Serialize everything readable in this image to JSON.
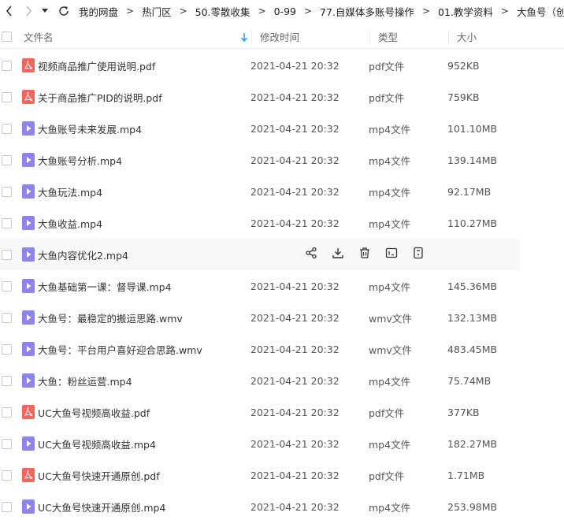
{
  "breadcrumb": [
    "我的网盘",
    "热门区",
    "50.零散收集",
    "0-99",
    "77.自媒体多账号操作",
    "01.教学资料",
    "大鱼号（创作运营）"
  ],
  "breadcrumb_separator": ">",
  "columns": {
    "name": "文件名",
    "modified": "修改时间",
    "type": "类型",
    "size": "大小"
  },
  "colors": {
    "pdf_icon": "#f4645f",
    "video_icon": "#8c84f2",
    "sort_arrow": "#2b8ff6",
    "hover_row": "#f7f8fa"
  },
  "files": [
    {
      "name": "视频商品推广使用说明.pdf",
      "date": "2021-04-21 20:32",
      "type": "pdf文件",
      "size": "952KB",
      "icon": "pdf-icon"
    },
    {
      "name": "关于商品推广PID的说明.pdf",
      "date": "2021-04-21 20:32",
      "type": "pdf文件",
      "size": "759KB",
      "icon": "pdf-icon"
    },
    {
      "name": "大鱼账号未来发展.mp4",
      "date": "2021-04-21 20:32",
      "type": "mp4文件",
      "size": "101.10MB",
      "icon": "video-icon"
    },
    {
      "name": "大鱼账号分析.mp4",
      "date": "2021-04-21 20:32",
      "type": "mp4文件",
      "size": "139.14MB",
      "icon": "video-icon"
    },
    {
      "name": "大鱼玩法.mp4",
      "date": "2021-04-21 20:32",
      "type": "mp4文件",
      "size": "92.17MB",
      "icon": "video-icon"
    },
    {
      "name": "大鱼收益.mp4",
      "date": "2021-04-21 20:32",
      "type": "mp4文件",
      "size": "110.27MB",
      "icon": "video-icon"
    },
    {
      "name": "大鱼内容优化2.mp4",
      "date": "",
      "type": "",
      "size": "",
      "icon": "video-icon",
      "hovered": true
    },
    {
      "name": "大鱼基础第一课：督导课.mp4",
      "date": "2021-04-21 20:32",
      "type": "mp4文件",
      "size": "145.36MB",
      "icon": "video-icon"
    },
    {
      "name": "大鱼号：最稳定的搬运思路.wmv",
      "date": "2021-04-21 20:32",
      "type": "wmv文件",
      "size": "132.13MB",
      "icon": "video-icon"
    },
    {
      "name": "大鱼号：平台用户喜好迎合思路.wmv",
      "date": "2021-04-21 20:32",
      "type": "wmv文件",
      "size": "483.45MB",
      "icon": "video-icon"
    },
    {
      "name": "大鱼：粉丝运营.mp4",
      "date": "2021-04-21 20:32",
      "type": "mp4文件",
      "size": "75.74MB",
      "icon": "video-icon"
    },
    {
      "name": "UC大鱼号视频高收益.pdf",
      "date": "2021-04-21 20:32",
      "type": "pdf文件",
      "size": "377KB",
      "icon": "pdf-icon"
    },
    {
      "name": "UC大鱼号视频高收益.mp4",
      "date": "2021-04-21 20:32",
      "type": "mp4文件",
      "size": "182.27MB",
      "icon": "video-icon"
    },
    {
      "name": "UC大鱼号快速开通原创.pdf",
      "date": "2021-04-21 20:32",
      "type": "pdf文件",
      "size": "1.71MB",
      "icon": "pdf-icon"
    },
    {
      "name": "UC大鱼号快速开通原创.mp4",
      "date": "2021-04-21 20:32",
      "type": "mp4文件",
      "size": "253.98MB",
      "icon": "video-icon"
    }
  ],
  "row_actions": [
    "share-icon",
    "download-icon",
    "delete-icon",
    "rename-icon",
    "more-icon"
  ]
}
